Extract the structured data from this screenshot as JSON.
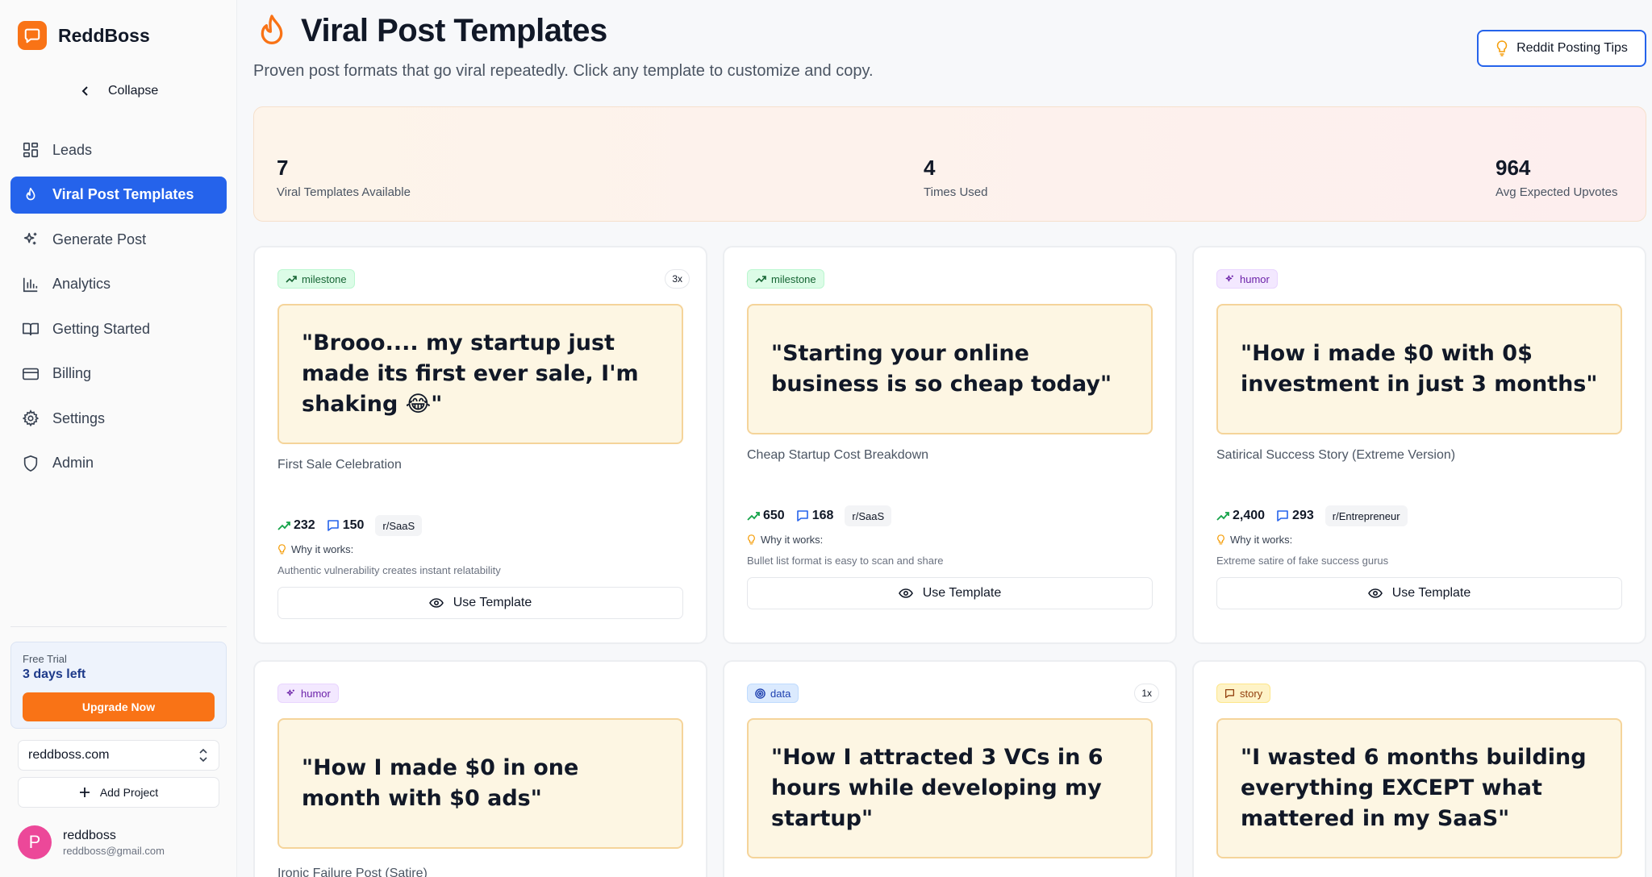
{
  "app": {
    "name": "ReddBoss",
    "collapse_label": "Collapse"
  },
  "sidebar": {
    "items": [
      {
        "label": "Leads",
        "icon": "grid-icon"
      },
      {
        "label": "Viral Post Templates",
        "icon": "flame-icon",
        "active": true
      },
      {
        "label": "Generate Post",
        "icon": "sparkles-icon"
      },
      {
        "label": "Analytics",
        "icon": "bar-chart-icon"
      },
      {
        "label": "Getting Started",
        "icon": "book-icon"
      },
      {
        "label": "Billing",
        "icon": "credit-card-icon"
      },
      {
        "label": "Settings",
        "icon": "gear-icon"
      },
      {
        "label": "Admin",
        "icon": "shield-icon"
      }
    ],
    "trial": {
      "label": "Free Trial",
      "days": "3 days left",
      "upgrade": "Upgrade Now"
    },
    "project": {
      "selected": "reddboss.com",
      "add_label": "Add Project"
    },
    "user": {
      "initial": "P",
      "name": "reddboss",
      "email": "reddboss@gmail.com"
    }
  },
  "header": {
    "title": "Viral Post Templates",
    "subtitle": "Proven post formats that go viral repeatedly. Click any template to customize and copy.",
    "tips_button": "Reddit Posting Tips"
  },
  "stats": [
    {
      "value": "7",
      "label": "Viral Templates Available"
    },
    {
      "value": "4",
      "label": "Times Used"
    },
    {
      "value": "964",
      "label": "Avg Expected Upvotes"
    }
  ],
  "use_template_label": "Use Template",
  "why_label": "Why it works:",
  "colors": {
    "accent": "#2563eb",
    "brand": "#f97316"
  },
  "templates": [
    {
      "tag": "milestone",
      "usage": "3x",
      "hook": "\"Brooo.... my startup just made its first ever sale, I'm shaking 😂\"",
      "name": "First Sale Celebration",
      "upvotes": "232",
      "comments": "150",
      "subreddit": "r/SaaS",
      "why": "Authentic vulnerability creates instant relatability"
    },
    {
      "tag": "milestone",
      "usage": "",
      "hook": "\"Starting your online business is so cheap today\"",
      "name": "Cheap Startup Cost Breakdown",
      "upvotes": "650",
      "comments": "168",
      "subreddit": "r/SaaS",
      "why": "Bullet list format is easy to scan and share"
    },
    {
      "tag": "humor",
      "usage": "",
      "hook": "\"How i made $0 with 0$ investment in just 3 months\"",
      "name": "Satirical Success Story (Extreme Version)",
      "upvotes": "2,400",
      "comments": "293",
      "subreddit": "r/Entrepreneur",
      "why": "Extreme satire of fake success gurus"
    },
    {
      "tag": "humor",
      "usage": "",
      "hook": "\"How I made $0 in one month with $0 ads\"",
      "name": "Ironic Failure Post (Satire)"
    },
    {
      "tag": "data",
      "usage": "1x",
      "hook": "\"How I attracted 3 VCs in 6 hours while developing my startup\""
    },
    {
      "tag": "story",
      "usage": "",
      "hook": "\"I wasted 6 months building everything EXCEPT what mattered in my SaaS\""
    }
  ]
}
